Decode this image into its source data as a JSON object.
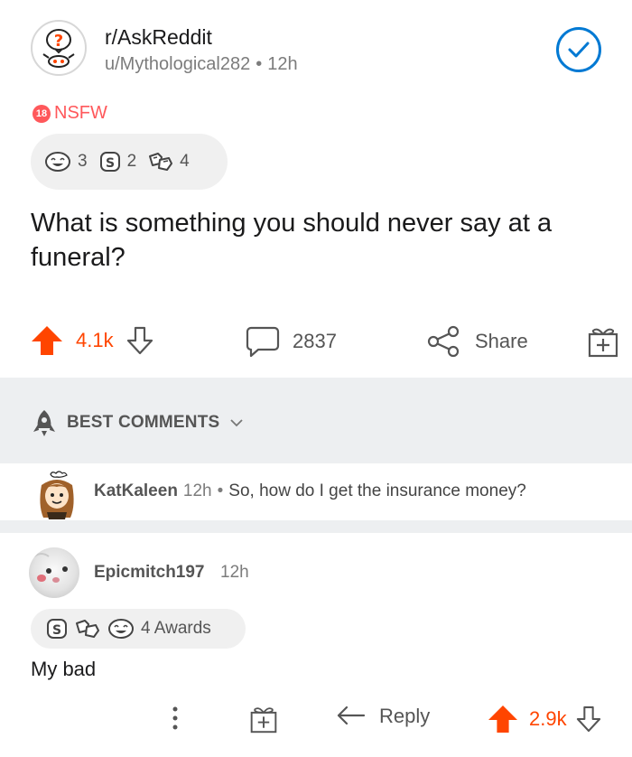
{
  "post": {
    "subreddit": "r/AskReddit",
    "author": "u/Mythological282",
    "time": "12h",
    "nsfw_badge": "18",
    "nsfw_label": "NSFW",
    "awards": [
      {
        "icon": "laughing-face-award-icon",
        "count": "3"
      },
      {
        "icon": "silver-award-icon",
        "count": "2"
      },
      {
        "icon": "fist-bump-award-icon",
        "count": "4"
      }
    ],
    "title": "What is something you should never say at a funeral?",
    "score": "4.1k",
    "comments_count": "2837",
    "share_label": "Share"
  },
  "sort": {
    "label": "BEST COMMENTS"
  },
  "comments": [
    {
      "author": "KatKaleen",
      "time": "12h",
      "text": "So, how do I get the insurance money?"
    },
    {
      "author": "Epicmitch197",
      "time": "12h",
      "awards_label": "4 Awards",
      "award_icons": [
        "silver-award-icon",
        "fist-bump-award-icon",
        "laughing-face-award-icon"
      ],
      "body": "My bad",
      "reply_label": "Reply",
      "score": "2.9k"
    }
  ],
  "colors": {
    "upvote": "#ff4500",
    "joined_blue": "#0079d3",
    "nsfw": "#ff585b",
    "strip_bg": "#edeff1"
  }
}
